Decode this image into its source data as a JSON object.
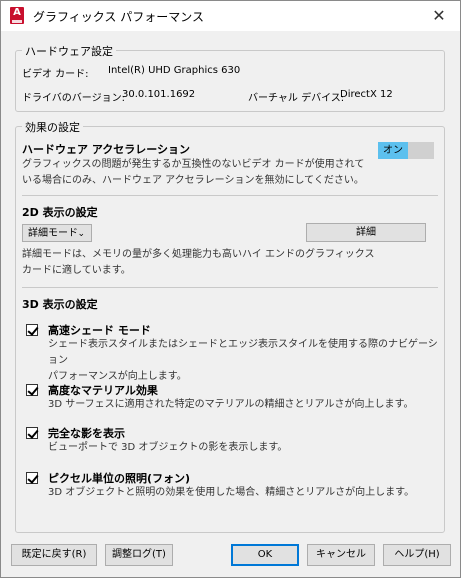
{
  "window": {
    "title": "グラフィックス パフォーマンス",
    "close": "✕"
  },
  "hardware": {
    "legend": "ハードウェア設定",
    "video_card_label": "ビデオ カード:",
    "video_card_value": "Intel(R) UHD Graphics 630",
    "driver_label": "ドライバのバージョン:",
    "driver_value": "30.0.101.1692",
    "virtual_device_label": "バーチャル デバイス:",
    "virtual_device_value": "DirectX 12"
  },
  "effects": {
    "legend": "効果の設定",
    "hw_accel": {
      "title": "ハードウェア アクセラレーション",
      "toggle": "オン",
      "desc_line1": "グラフィックスの問題が発生するか互換性のないビデオ カードが使用されて",
      "desc_line2": "いる場合にのみ、ハードウェア アクセラレーションを無効にしてください。"
    },
    "display2d": {
      "title": "2D 表示の設定",
      "select_value": "詳細モード",
      "details_button": "詳細",
      "desc_line1": "詳細モードは、メモリの量が多く処理能力も高いハイ エンドのグラフィックス",
      "desc_line2": "カードに適しています。"
    },
    "display3d": {
      "title": "3D 表示の設定",
      "options": [
        {
          "title": "高速シェード モード",
          "desc1": "シェード表示スタイルまたはシェードとエッジ表示スタイルを使用する際のナビゲーション",
          "desc2": "パフォーマンスが向上します。"
        },
        {
          "title": "高度なマテリアル効果",
          "desc1": "3D サーフェスに適用された特定のマテリアルの精細さとリアルさが向上します。",
          "desc2": ""
        },
        {
          "title": "完全な影を表示",
          "desc1": "ビューポートで 3D オブジェクトの影を表示します。",
          "desc2": ""
        },
        {
          "title": "ピクセル単位の照明(フォン)",
          "desc1": "3D オブジェクトと照明の効果を使用した場合、精細さとリアルさが向上します。",
          "desc2": ""
        }
      ]
    }
  },
  "buttons": {
    "reset": "既定に戻す(R)",
    "log": "調整ログ(T)",
    "ok": "OK",
    "cancel": "キャンセル",
    "help": "ヘルプ(H)"
  },
  "colors": {
    "toggle_on": "#5cc0ee",
    "brand_icon": "#c8102e",
    "primary_border": "#0078d7"
  }
}
